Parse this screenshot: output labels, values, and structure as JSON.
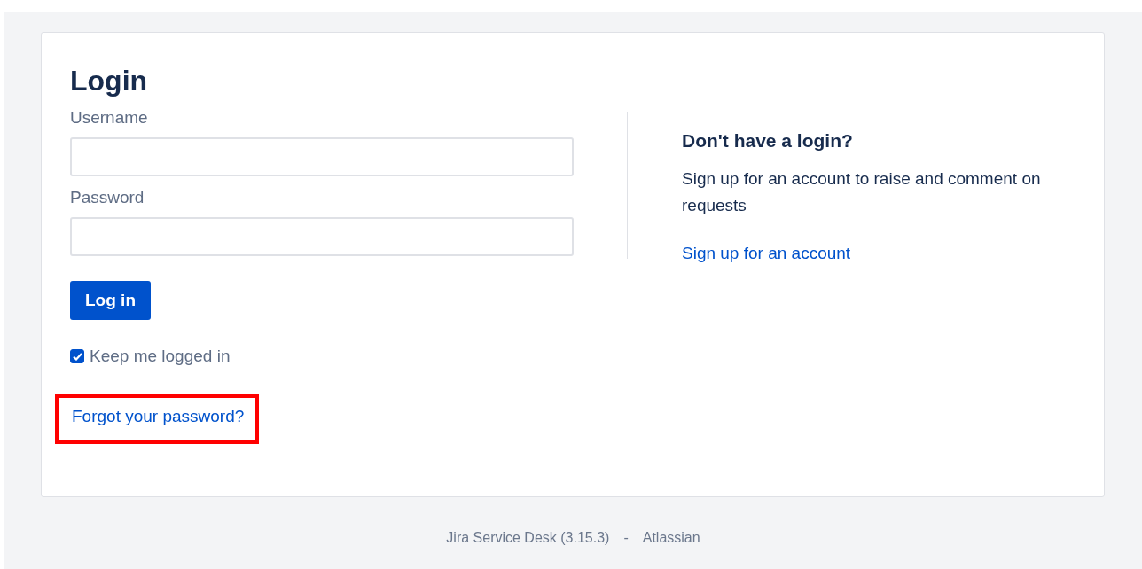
{
  "login": {
    "title": "Login",
    "fields": [
      {
        "label": "Username"
      },
      {
        "label": "Password"
      }
    ],
    "submit_button": "Log in",
    "keep_logged_in": {
      "label": "Keep me logged in",
      "checked": true
    },
    "forgot_link": {
      "text": "Forgot your password?",
      "highlighted": true
    }
  },
  "signup": {
    "heading": "Don't have a login?",
    "text": "Sign up for an account to raise and comment on requests",
    "link": "Sign up for an account"
  },
  "footer": {
    "product": "Jira Service Desk (3.15.3)",
    "separator": "-",
    "company": "Atlassian"
  }
}
